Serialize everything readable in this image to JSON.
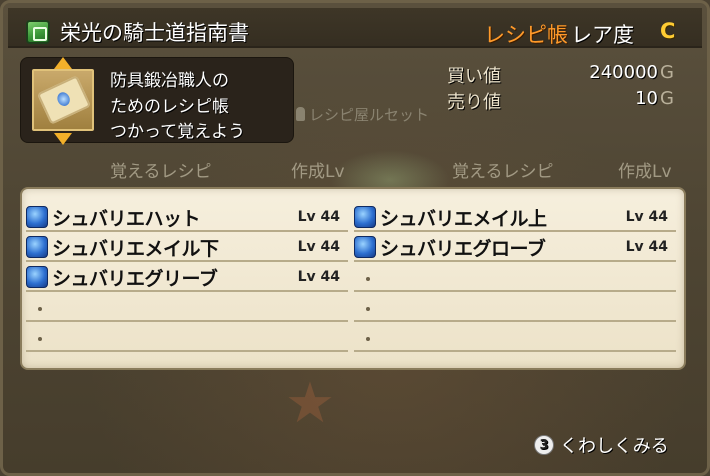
{
  "header": {
    "title": "栄光の騎士道指南書",
    "recipe_book_label": "レシピ帳",
    "rarity_label": "レア度",
    "rarity_value": "C"
  },
  "item": {
    "description_lines": [
      "防具鍛冶職人の",
      "ためのレシピ帳",
      "つかって覚えよう"
    ]
  },
  "prices": {
    "buy_label": "買い値",
    "buy_value": "240000",
    "sell_label": "売り値",
    "sell_value": "10",
    "unit": "G"
  },
  "npc_hint": "レシピ屋ルセット",
  "columns": {
    "recipe_header": "覚えるレシピ",
    "level_header": "作成Lv"
  },
  "recipes": {
    "left": [
      {
        "name": "シュバリエハット",
        "level": "Lv 44"
      },
      {
        "name": "シュバリエメイル下",
        "level": "Lv 44"
      },
      {
        "name": "シュバリエグリーブ",
        "level": "Lv 44"
      }
    ],
    "right": [
      {
        "name": "シュバリエメイル上",
        "level": "Lv 44"
      },
      {
        "name": "シュバリエグローブ",
        "level": "Lv 44"
      }
    ]
  },
  "footer": {
    "button_number": "3",
    "label": "くわしくみる"
  },
  "colors": {
    "accent_orange": "#ff9a2a",
    "rarity_gold": "#ffcc33",
    "panel_bg": "#f6efdd"
  }
}
